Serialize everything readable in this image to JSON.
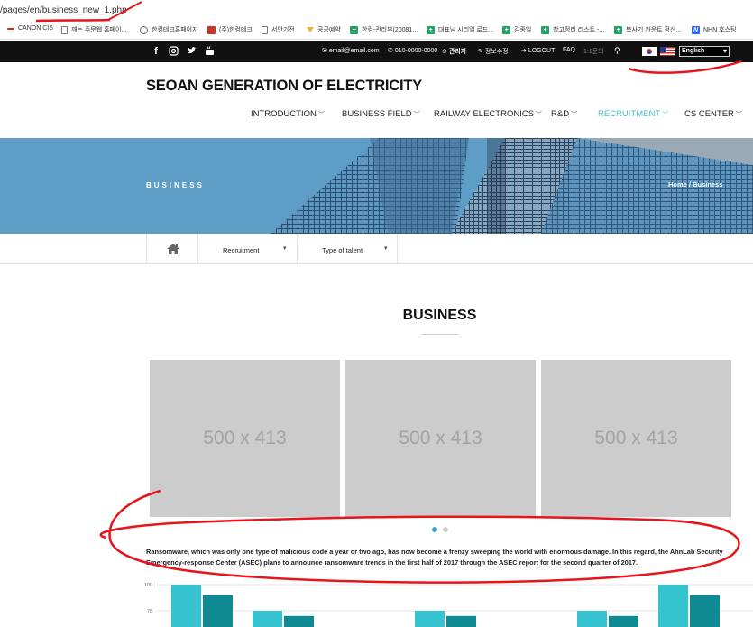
{
  "browser": {
    "url": "/pages/en/business_new_1.php",
    "bookmarks": [
      {
        "label": "CANON CIS",
        "icon": "dash-icon"
      },
      {
        "label": "깨는 주문웹 홈페이...",
        "icon": "page-icon"
      },
      {
        "label": "한컴테크홈페이지",
        "icon": "globe-icon"
      },
      {
        "label": "(주)한컴테크",
        "icon": "red-doc-icon"
      },
      {
        "label": "서안기전",
        "icon": "page-icon"
      },
      {
        "label": "공공예약",
        "icon": "pin-icon"
      },
      {
        "label": "한컴-관리부(20081...",
        "icon": "sheets-icon"
      },
      {
        "label": "대표님 시리얼 로드...",
        "icon": "sheets-icon"
      },
      {
        "label": "김종일",
        "icon": "sheets-icon"
      },
      {
        "label": "창고정리 리스트 -...",
        "icon": "sheets-icon"
      },
      {
        "label": "복사기 카운트 정산...",
        "icon": "sheets-icon"
      },
      {
        "label": "NHN 호스팅",
        "icon": "nhn-icon"
      }
    ]
  },
  "topbar": {
    "email": "email@email.com",
    "phone": "010-0000-0000",
    "admin": "관리자",
    "edit_info": "정보수정",
    "logout": "LOGOUT",
    "faq": "FAQ",
    "inquiry": "1:1문의",
    "language": "English"
  },
  "header": {
    "site_title": "SEOAN GENERATION OF ELECTRICITY",
    "nav": [
      {
        "label": "INTRODUCTION"
      },
      {
        "label": "BUSINESS FIELD"
      },
      {
        "label": "RAILWAY ELECTRONICS"
      },
      {
        "label": "R&D"
      },
      {
        "label": "RECRUITMENT"
      },
      {
        "label": "CS CENTER"
      }
    ]
  },
  "banner": {
    "title": "BUSINESS",
    "breadcrumb": "Home / Business"
  },
  "subnav": {
    "items": [
      {
        "label": "Recruitment"
      },
      {
        "label": "Type of talent"
      }
    ]
  },
  "main": {
    "section_title": "BUSINESS",
    "placeholders": [
      "500 x 413",
      "500 x 413",
      "500 x 413"
    ],
    "paragraph": "Ransomware, which was only one type of malicious code a year or two ago, has now become a frenzy sweeping the world with enormous damage. In this regard, the AhnLab Security Emergency-response Center (ASEC) plans to announce ransomware trends in the first half of 2017 through the ASEC report for the second quarter of 2017."
  },
  "colors": {
    "accent": "#3fbfc9",
    "topbar_bg": "#111111",
    "placeholder_bg": "#cccccc",
    "bar_light": "#35c3d0",
    "bar_dark": "#0f8a93",
    "annotation": "#e8141b"
  },
  "chart_data": {
    "type": "bar",
    "yticks": [
      "100",
      "75"
    ],
    "series": [
      {
        "values": [
          100,
          75,
          75,
          75,
          100
        ]
      },
      {
        "values": [
          90,
          70,
          70,
          70,
          90
        ]
      }
    ]
  }
}
